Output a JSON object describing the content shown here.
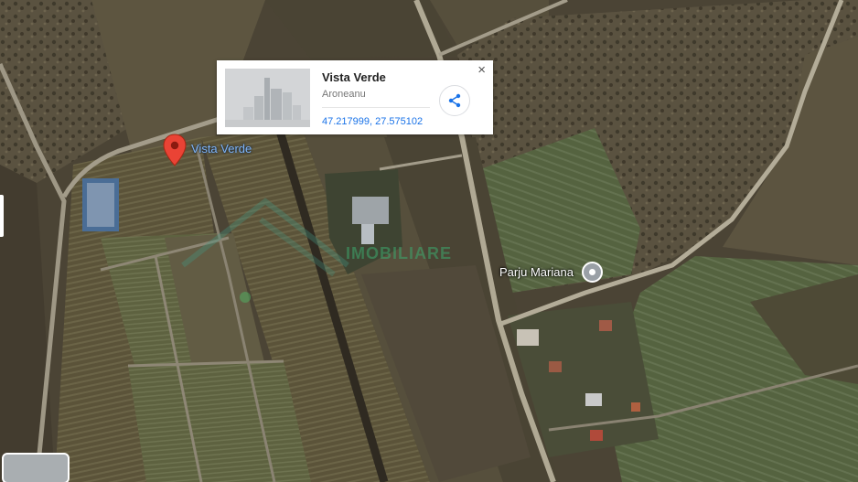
{
  "map": {
    "type": "satellite",
    "colors": {
      "dark_field": "#4d4637",
      "vineyard": "#5e5a3c",
      "green_field": "#55623f",
      "road": "#a39c8a",
      "pin_red": "#ea4335",
      "link_blue": "#1a73e8"
    }
  },
  "popup": {
    "title": "Vista Verde",
    "subtitle": "Aroneanu",
    "coordinates": "47.217999, 27.575102",
    "close_glyph": "×",
    "share_icon": "share-icon"
  },
  "markers": {
    "vista_verde": {
      "label": "Vista Verde",
      "icon": "red-pin-icon"
    },
    "parju_mariana": {
      "label": "Parju Mariana",
      "icon": "gray-place-icon"
    }
  },
  "watermark": {
    "text": "IMOBILIARE"
  }
}
